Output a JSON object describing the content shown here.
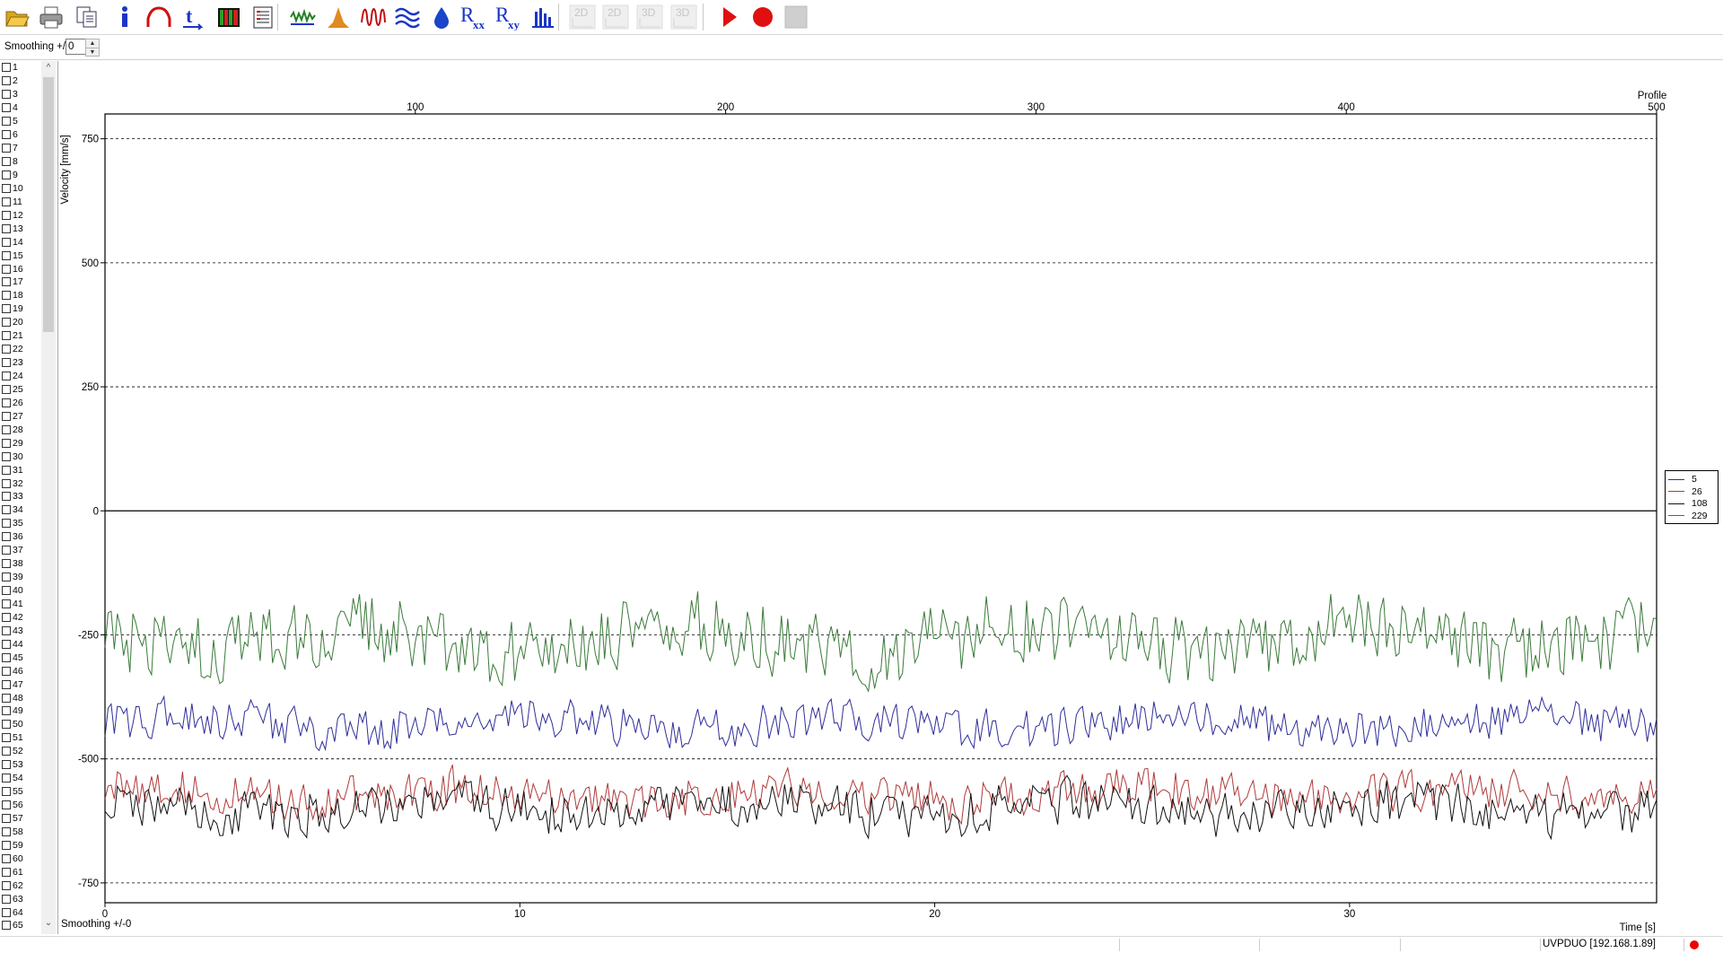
{
  "toolbar": {
    "buttons": [
      {
        "name": "open-file-icon",
        "enabled": true
      },
      {
        "name": "print-icon",
        "enabled": true
      },
      {
        "name": "copy-icon",
        "enabled": true
      },
      {
        "name": "info-icon",
        "enabled": true
      },
      {
        "name": "profile-curve-icon",
        "enabled": true
      },
      {
        "name": "time-axis-icon",
        "enabled": true
      },
      {
        "name": "color-bars-icon",
        "enabled": true
      },
      {
        "name": "table-icon",
        "enabled": true
      },
      {
        "name": "time-series-icon",
        "enabled": true
      },
      {
        "name": "histogram-icon",
        "enabled": true
      },
      {
        "name": "waveform-icon",
        "enabled": true
      },
      {
        "name": "waves-icon",
        "enabled": true
      },
      {
        "name": "droplet-icon",
        "enabled": true
      },
      {
        "name": "rxx-icon",
        "label": "R",
        "sub": "xx",
        "enabled": true
      },
      {
        "name": "rxy-icon",
        "label": "R",
        "sub": "xy",
        "enabled": true
      },
      {
        "name": "spectrum-bars-icon",
        "enabled": true
      },
      {
        "name": "2d-view-icon",
        "label": "2D",
        "enabled": false
      },
      {
        "name": "2d-view-alt-icon",
        "label": "2D",
        "enabled": false
      },
      {
        "name": "3d-view-icon",
        "label": "3D",
        "enabled": false
      },
      {
        "name": "3d-view-alt-icon",
        "label": "3D",
        "enabled": false
      },
      {
        "name": "play-icon",
        "enabled": true
      },
      {
        "name": "record-icon",
        "enabled": true
      },
      {
        "name": "stop-icon",
        "enabled": false
      }
    ]
  },
  "smoothing": {
    "label": "Smoothing +/-",
    "value": "0",
    "bottom_label": "Smoothing +/-0"
  },
  "channels": [
    "1",
    "2",
    "3",
    "4",
    "5",
    "6",
    "7",
    "8",
    "9",
    "10",
    "11",
    "12",
    "13",
    "14",
    "15",
    "16",
    "17",
    "18",
    "19",
    "20",
    "21",
    "22",
    "23",
    "24",
    "25",
    "26",
    "27",
    "28",
    "29",
    "30",
    "31",
    "32",
    "33",
    "34",
    "35",
    "36",
    "37",
    "38",
    "39",
    "40",
    "41",
    "42",
    "43",
    "44",
    "45",
    "46",
    "47",
    "48",
    "49",
    "50",
    "51",
    "52",
    "53",
    "54",
    "55",
    "56",
    "57",
    "58",
    "59",
    "60",
    "61",
    "62",
    "63",
    "64",
    "65"
  ],
  "chart_data": {
    "type": "line",
    "ylabel": "Velocity [mm/s]",
    "xlabel": "Time [s]",
    "x2label": "Profile",
    "xlim": [
      0,
      37.4
    ],
    "x_ticks": [
      0,
      10,
      20,
      30
    ],
    "x2lim": [
      0,
      500
    ],
    "x2_ticks": [
      100,
      200,
      300,
      400,
      500
    ],
    "ylim": [
      -790,
      800
    ],
    "y_ticks": [
      750,
      500,
      250,
      0,
      -250,
      -500,
      -750
    ],
    "grid": "horizontal dashed",
    "legend_position": "right",
    "series": [
      {
        "name": "5",
        "color": "#2e2e9a",
        "mean": -430,
        "amplitude": 45
      },
      {
        "name": "26",
        "color": "#b03a3a",
        "mean": -570,
        "amplitude": 45
      },
      {
        "name": "108",
        "color": "#111111",
        "mean": -600,
        "amplitude": 50
      },
      {
        "name": "229",
        "color": "#3a7a3a",
        "mean": -260,
        "amplitude": 80
      }
    ]
  },
  "status": {
    "connection": "UVPDUO [192.168.1.89]"
  }
}
